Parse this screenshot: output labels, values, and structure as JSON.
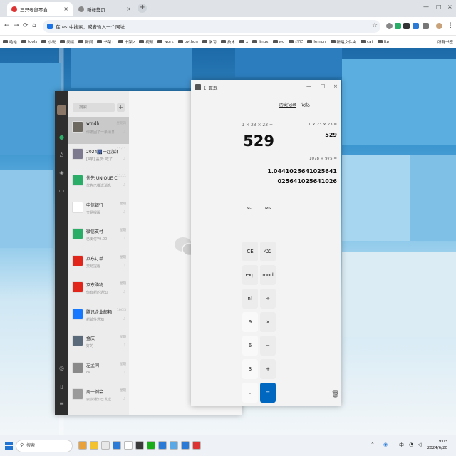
{
  "browser": {
    "tabs": [
      {
        "label": "三只老鼠零食",
        "active": true
      },
      {
        "label": "新标签页",
        "active": false
      }
    ],
    "new_tab": "+",
    "omnibox": {
      "placeholder": "在test中搜索，或者输入一个网址"
    },
    "bookmarks": [
      "哈哈",
      "tools",
      "小说",
      "阅读",
      "新闻",
      "书架1",
      "书架2",
      "视频",
      "work",
      "python",
      "学习",
      "技术",
      "x",
      "linux",
      "wo",
      "红军",
      "lemon",
      "新建文件夹",
      "cat",
      "ftp"
    ],
    "bookmarks_all": "所有书签"
  },
  "wechat": {
    "search_placeholder": "搜索",
    "chats": [
      {
        "name": "wmdh",
        "preview": "你撤回了一条消息",
        "time": "星期四",
        "color": "#6d6860"
      },
      {
        "name": "2024🎆一起加油",
        "preview": "[4条] 盖茨: 吃了",
        "time": "11:11",
        "color": "#7d7a90"
      },
      {
        "name": "优先 UNIQUE C…",
        "preview": "优先已推送消息",
        "time": "11:11",
        "color": "#2aae67"
      },
      {
        "name": "中信银行",
        "preview": "交易提醒",
        "time": "星期",
        "color": "#ffffff"
      },
      {
        "name": "微信支付",
        "preview": "已支付¥9.00",
        "time": "星期",
        "color": "#2aae67"
      },
      {
        "name": "京东订单",
        "preview": "交易提醒",
        "time": "星期",
        "color": "#e1251b"
      },
      {
        "name": "京东购物",
        "preview": "你有新的通知",
        "time": "星期",
        "color": "#e1251b"
      },
      {
        "name": "腾讯企业邮箱",
        "preview": "新邮件通知",
        "time": "10/23",
        "color": "#1677ff"
      },
      {
        "name": "金庆",
        "preview": "好的",
        "time": "星期",
        "color": "#5a6a7a"
      },
      {
        "name": "左孟同",
        "preview": "ok",
        "time": "星期",
        "color": "#8a8a8a"
      },
      {
        "name": "周一例会",
        "preview": "会议通知已发送",
        "time": "星期",
        "color": "#9a9a9a"
      }
    ]
  },
  "calculator": {
    "title": "计算器",
    "expression": "1 × 23 × 23 =",
    "result": "529",
    "memory": [
      "M-",
      "MS"
    ],
    "history_tabs": [
      "历史记录",
      "记忆"
    ],
    "history": [
      {
        "expr": "1 × 23 × 23 =",
        "res": "529"
      },
      {
        "expr": "1078 ÷ 975 =",
        "res": "1.0441025641025641025641025641026"
      }
    ],
    "keys": [
      {
        "label": "CE",
        "col": 0,
        "row": 0,
        "kind": "gray"
      },
      {
        "label": "⌫",
        "col": 1,
        "row": 0,
        "kind": "gray"
      },
      {
        "label": "exp",
        "col": 0,
        "row": 1,
        "kind": "gray"
      },
      {
        "label": "mod",
        "col": 1,
        "row": 1,
        "kind": "gray"
      },
      {
        "label": "n!",
        "col": 0,
        "row": 2,
        "kind": "gray"
      },
      {
        "label": "÷",
        "col": 1,
        "row": 2,
        "kind": "gray"
      },
      {
        "label": "9",
        "col": 0,
        "row": 3,
        "kind": "num"
      },
      {
        "label": "×",
        "col": 1,
        "row": 3,
        "kind": "gray"
      },
      {
        "label": "6",
        "col": 0,
        "row": 4,
        "kind": "num"
      },
      {
        "label": "−",
        "col": 1,
        "row": 4,
        "kind": "gray"
      },
      {
        "label": "3",
        "col": 0,
        "row": 5,
        "kind": "num"
      },
      {
        "label": "+",
        "col": 1,
        "row": 5,
        "kind": "gray"
      },
      {
        "label": ".",
        "col": 0,
        "row": 6,
        "kind": "num"
      },
      {
        "label": "=",
        "col": 1,
        "row": 6,
        "kind": "eq"
      }
    ]
  },
  "taskbar": {
    "search": "搜索",
    "apps": [
      "#e9a23b",
      "#f2c230",
      "#e8e8e8",
      "#2b7bd6",
      "#ffffff",
      "#3a3a3a",
      "#1aad19",
      "#2b7bd6",
      "#5aa9e6",
      "#2b7bd6",
      "#d33"
    ],
    "tray_lang": "中",
    "time": "9:03",
    "date": "2024/6/20"
  }
}
